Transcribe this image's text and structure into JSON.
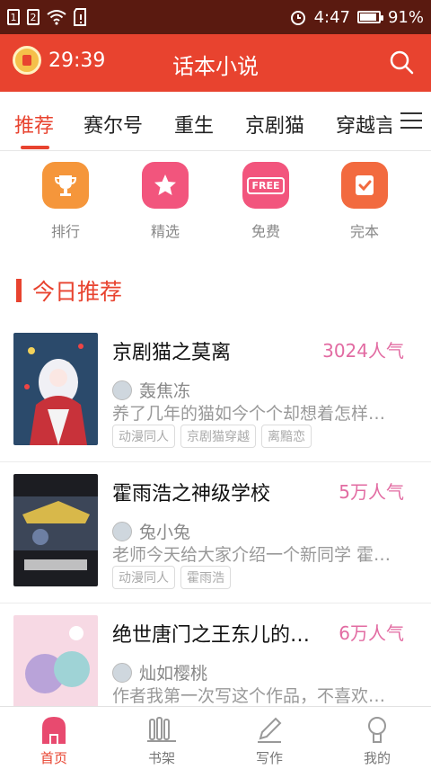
{
  "status_bar": {
    "sim1": "1",
    "sim2": "2",
    "time": "4:47",
    "battery": "91%",
    "battery_level": 0.91
  },
  "header": {
    "timer": "29:39",
    "title": "话本小说"
  },
  "tabs": [
    "推荐",
    "赛尔号",
    "重生",
    "京剧猫",
    "穿越言"
  ],
  "active_tab": 0,
  "quick_links": [
    {
      "label": "排行",
      "icon": "trophy-icon",
      "color": "#f5963b"
    },
    {
      "label": "精选",
      "icon": "star-icon",
      "color": "#f2557d"
    },
    {
      "label": "免费",
      "icon": "free-icon",
      "color": "#f2557d",
      "badge": "FREE"
    },
    {
      "label": "完本",
      "icon": "completed-icon",
      "color": "#f26a3f"
    }
  ],
  "section": {
    "title": "今日推荐"
  },
  "books": [
    {
      "title": "京剧猫之莫离",
      "popularity": "3024人气",
      "author": "轰焦冻",
      "description": "养了几年的猫如今个个却想着怎样…",
      "tags": [
        "动漫同人",
        "京剧猫穿越",
        "离黯恋"
      ]
    },
    {
      "title": "霍雨浩之神级学校",
      "popularity": "5万人气",
      "author": "兔小兔",
      "description": "老师今天给大家介绍一个新同学 霍…",
      "tags": [
        "动漫同人",
        "霍雨浩"
      ]
    },
    {
      "title": "绝世唐门之王东儿的…",
      "popularity": "6万人气",
      "author": "灿如樱桃",
      "description": "作者我第一次写这个作品，不喜欢…",
      "tags": []
    }
  ],
  "bottom_nav": [
    {
      "label": "首页",
      "icon": "home-icon"
    },
    {
      "label": "书架",
      "icon": "bookshelf-icon"
    },
    {
      "label": "写作",
      "icon": "pen-icon"
    },
    {
      "label": "我的",
      "icon": "profile-icon"
    }
  ],
  "active_nav": 0,
  "colors": {
    "accent": "#e8432f",
    "popularity": "#e26ba2",
    "status_bar": "#5a1a10"
  }
}
